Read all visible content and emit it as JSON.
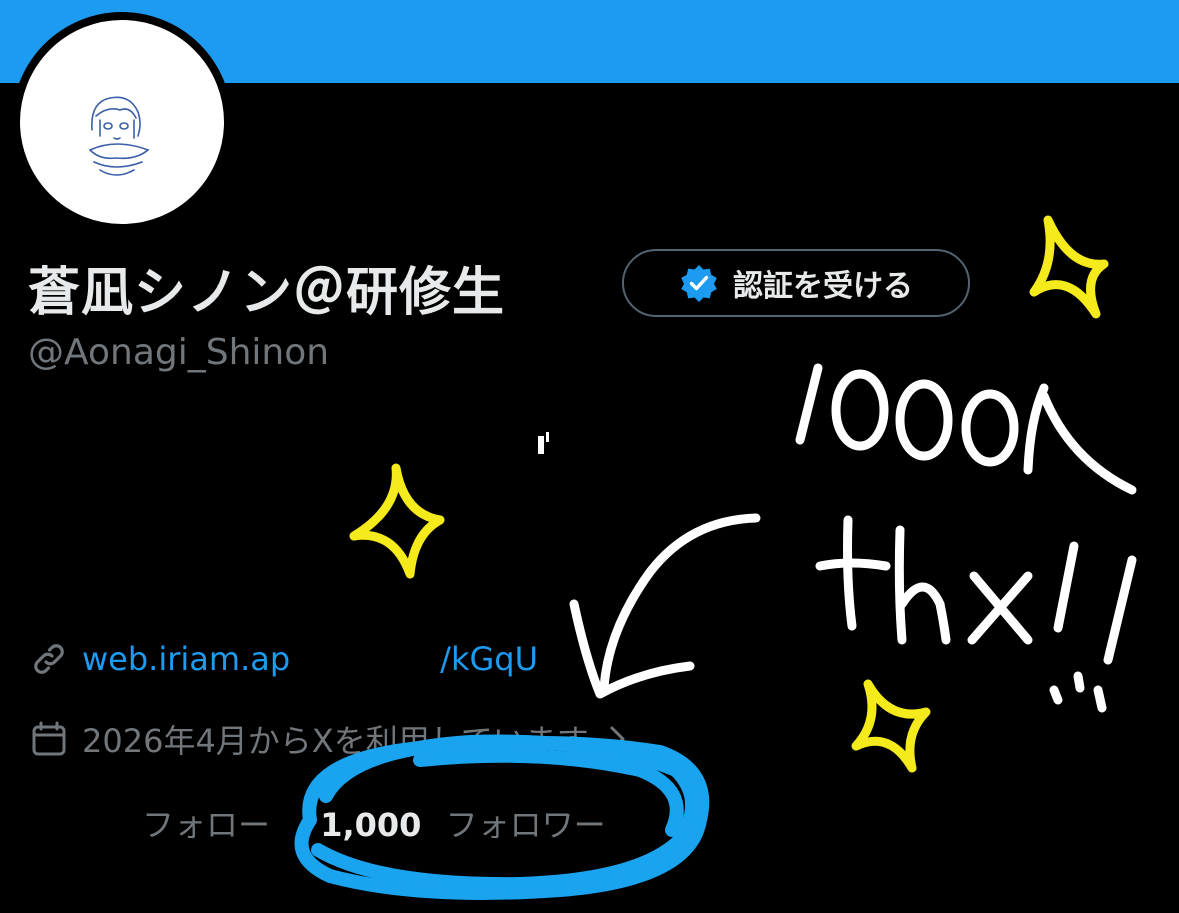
{
  "profile": {
    "display_name": "蒼凪シノン＠研修生",
    "handle": "@Aonagi_Shinon",
    "verify_button_label": "認証を受ける",
    "link_text": "web.iriam.ap",
    "link_text_tail": "/kGqU",
    "joined_text": "2026年4月からXを利用しています",
    "following_label": "フォロー",
    "followers_count": "1,000",
    "followers_label": "フォロワー"
  },
  "annotation": {
    "line1": "1000人",
    "line2": "thx!!",
    "colors": {
      "sparkle": "#f5ea1c",
      "circle": "#1aa3ee",
      "handwriting": "#ffffff"
    }
  },
  "colors": {
    "banner": "#1d9bf0",
    "background": "#000000",
    "link": "#1d9bf0",
    "muted": "#71767b",
    "verified_badge": "#1d9bf0"
  },
  "icons": [
    "verified-badge-icon",
    "link-icon",
    "calendar-icon",
    "chevron-right-icon"
  ]
}
